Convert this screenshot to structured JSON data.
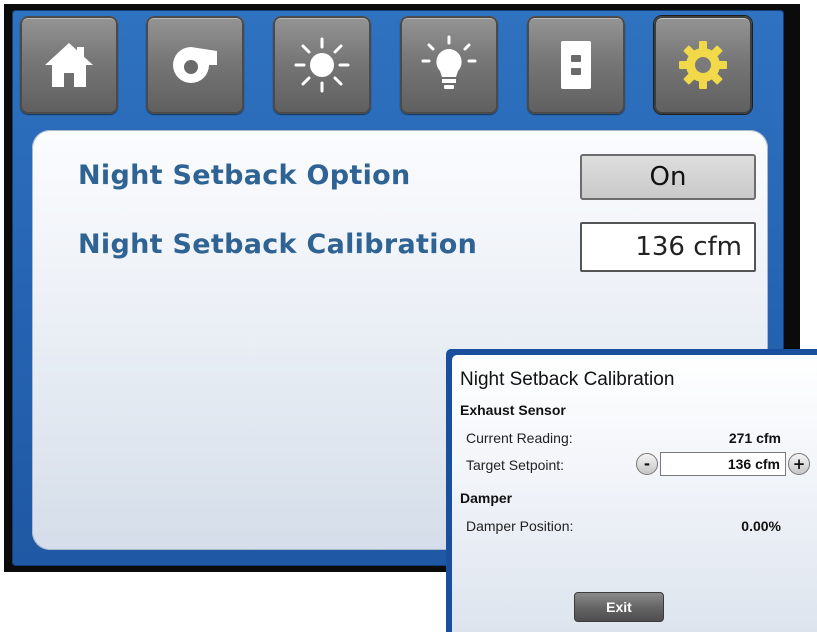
{
  "tabs": [
    {
      "icon": "home-icon"
    },
    {
      "icon": "fan-icon"
    },
    {
      "icon": "sun-icon"
    },
    {
      "icon": "lightbulb-icon"
    },
    {
      "icon": "door-icon"
    },
    {
      "icon": "gear-icon",
      "active": true
    }
  ],
  "main": {
    "night_setback_option": {
      "label": "Night Setback Option",
      "value": "On"
    },
    "night_setback_calibration": {
      "label": "Night Setback Calibration",
      "value": "136 cfm"
    }
  },
  "dialog": {
    "title": "Night Setback Calibration",
    "exhaust_section": "Exhaust Sensor",
    "current_reading_label": "Current Reading:",
    "current_reading_value": "271 cfm",
    "target_setpoint_label": "Target Setpoint:",
    "target_setpoint_value": "136 cfm",
    "decrement_label": "-",
    "increment_label": "+",
    "damper_section": "Damper",
    "damper_position_label": "Damper Position:",
    "damper_position_value": "0.00%",
    "exit_label": "Exit"
  },
  "colors": {
    "panel_blue": "#2563b2",
    "label_blue": "#2e6393",
    "gear_yellow": "#f2d94a",
    "icon_white": "#ffffff"
  }
}
